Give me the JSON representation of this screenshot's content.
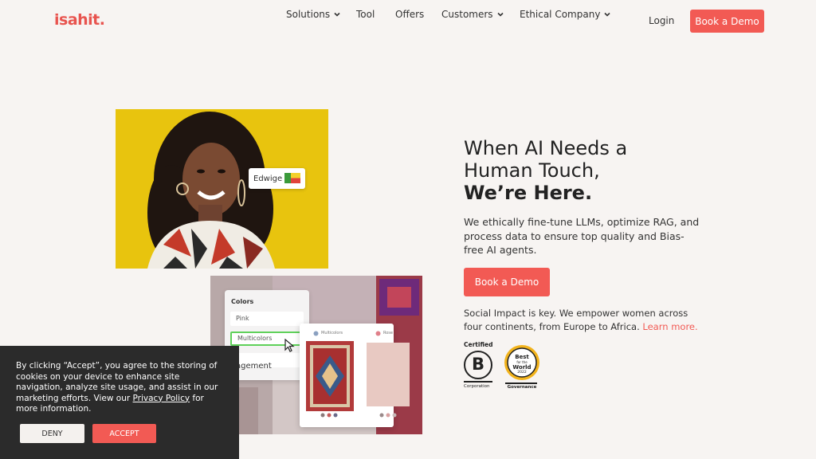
{
  "header": {
    "logo": "isahit.",
    "nav": [
      {
        "label": "Solutions",
        "has_dropdown": true
      },
      {
        "label": "Tool",
        "has_dropdown": false
      },
      {
        "label": "Offers",
        "has_dropdown": false
      },
      {
        "label": "Customers",
        "has_dropdown": true
      },
      {
        "label": "Ethical Company",
        "has_dropdown": true
      }
    ],
    "login": "Login",
    "cta": "Book a Demo"
  },
  "hero": {
    "photo_tag": "Edwige",
    "mockup": {
      "panel_title": "Colors",
      "options": [
        "Pink",
        "Multicolors"
      ],
      "selected": "Multicolors",
      "partial_label": "agement",
      "rug_labels": [
        "Multicolors",
        "Rose"
      ]
    },
    "headline_line1": "When AI Needs a",
    "headline_line2": "Human Touch,",
    "headline_line3": "We’re Here.",
    "subtext": "We ethically fine-tune LLMs, optimize RAG, and process data to ensure top quality and Bias-free AI agents.",
    "cta": "Book a Demo",
    "impact_text": "Social Impact is key. We empower women across four continents, from Europe to Africa.",
    "learn_more": "Learn more.",
    "badges": {
      "bcorp_top": "Certified",
      "bcorp_bottom": "Corporation",
      "bcorp_letter": "B",
      "best_line1": "Best",
      "best_line2": "for the",
      "best_line3": "World",
      "best_year": "2022",
      "best_bottom": "Governance"
    }
  },
  "cookie": {
    "text_before": "By clicking “Accept”, you agree to the storing of cookies on your device to enhance site navigation, analyze site usage, and assist in our marketing efforts. View our ",
    "policy_link": "Privacy Policy",
    "text_after": " for more information.",
    "deny": "DENY",
    "accept": "ACCEPT"
  },
  "colors": {
    "brand": "#f25a54",
    "background": "#f7f4f2",
    "cookie_bg": "#2b2b2b"
  }
}
